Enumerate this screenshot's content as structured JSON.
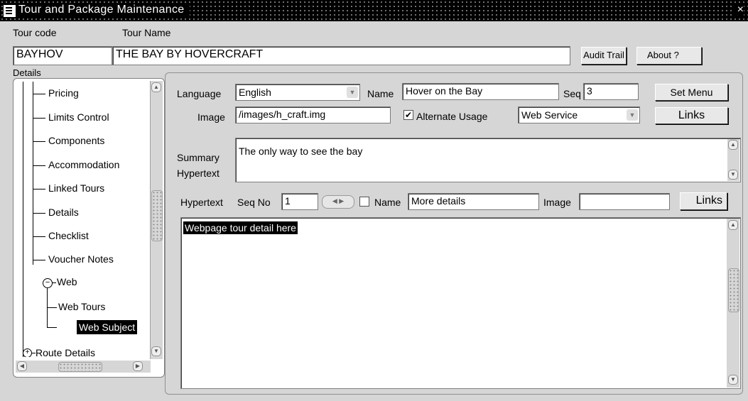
{
  "window": {
    "title": "Tour and Package Maintenance",
    "close_glyph": "×"
  },
  "header": {
    "tour_code_label": "Tour code",
    "tour_name_label": "Tour Name",
    "tour_code": "BAYHOV",
    "tour_name": "THE BAY BY HOVERCRAFT",
    "audit_trail_label": "Audit Trail",
    "about_label": "About ?"
  },
  "details_label": "Details",
  "tree": {
    "items": [
      {
        "label": "Pricing"
      },
      {
        "label": "Limits Control"
      },
      {
        "label": "Components"
      },
      {
        "label": "Accommodation"
      },
      {
        "label": "Linked Tours"
      },
      {
        "label": "Details"
      },
      {
        "label": "Checklist"
      },
      {
        "label": "Voucher Notes"
      },
      {
        "label": "Web"
      },
      {
        "label": "Web Tours"
      },
      {
        "label": "Web Subject"
      },
      {
        "label": "Route Details"
      }
    ],
    "selected": "Web Subject"
  },
  "form": {
    "language_label": "Language",
    "language_value": "English",
    "name_label": "Name",
    "name_value": "Hover on the Bay",
    "seq_label": "Seq",
    "seq_value": "3",
    "set_menu_label": "Set Menu",
    "image_label": "Image",
    "image_value": "/images/h_craft.img",
    "alternate_usage_label": "Alternate Usage",
    "alternate_usage_checked": true,
    "usage_value": "Web Service",
    "links_label": "Links",
    "summary_label": "Summary",
    "hypertext_label": "Hypertext",
    "summary_value": "The only way to see the bay"
  },
  "hypertext": {
    "label": "Hypertext",
    "seq_no_label": "Seq No",
    "seq_no_value": "1",
    "name_label": "Name",
    "name_value": "More details",
    "image_label": "Image",
    "image_value": "",
    "links_label": "Links",
    "body": "Webpage tour detail here"
  }
}
